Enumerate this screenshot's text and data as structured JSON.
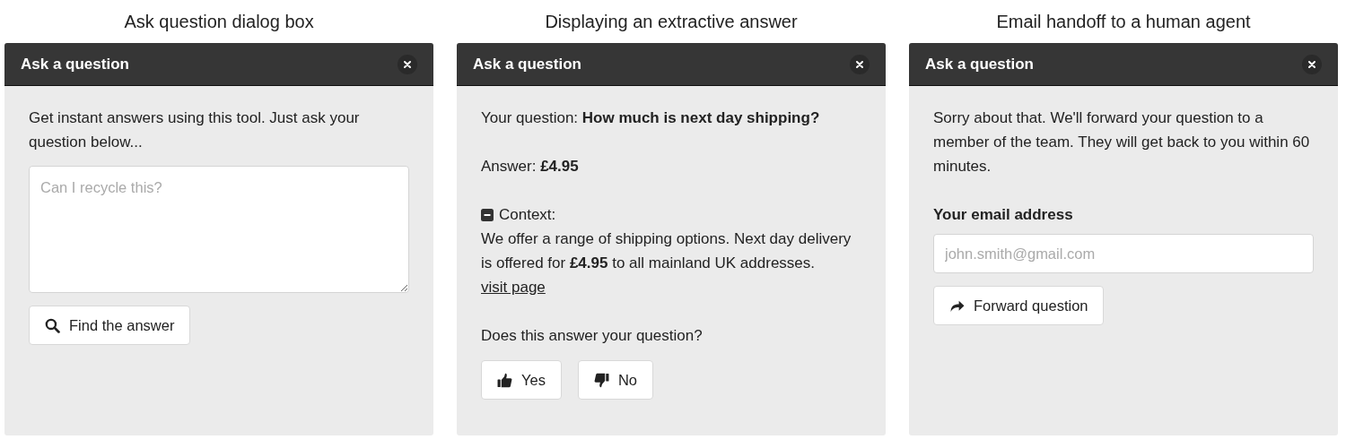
{
  "panels": [
    {
      "kind": "ask",
      "caption": "Ask question dialog box",
      "title": "Ask a question",
      "intro": "Get instant answers using this tool. Just ask your question below...",
      "field": {
        "placeholder": "Can I recycle this?"
      },
      "buttons": [
        {
          "label": "Find the answer",
          "kind": "search"
        }
      ]
    },
    {
      "kind": "answer",
      "caption": "Displaying an extractive answer",
      "title": "Ask a question",
      "question": "Your question: **How much is next day shipping?**",
      "answer": "Answer: **£4.95**",
      "context": {
        "label": "Context:",
        "expanded": true,
        "text": "We offer a range of shipping options. Next day delivery is offered for **£4.95** to all mainland UK addresses.",
        "link": "visit page"
      },
      "prompt": "Does this answer your question?",
      "buttons": [
        {
          "label": "Yes",
          "kind": "yes"
        },
        {
          "label": "No",
          "kind": "no"
        }
      ]
    },
    {
      "kind": "handoff",
      "caption": "Email handoff to a human agent",
      "title": "Ask a question",
      "intro": "Sorry about that. We'll forward your question to a member of the team. They will get back to you within 60 minutes.",
      "field_label": "Your email address",
      "field": {
        "placeholder": "john.smith@gmail.com"
      },
      "buttons": [
        {
          "label": "Forward question",
          "kind": "forward"
        }
      ]
    }
  ]
}
